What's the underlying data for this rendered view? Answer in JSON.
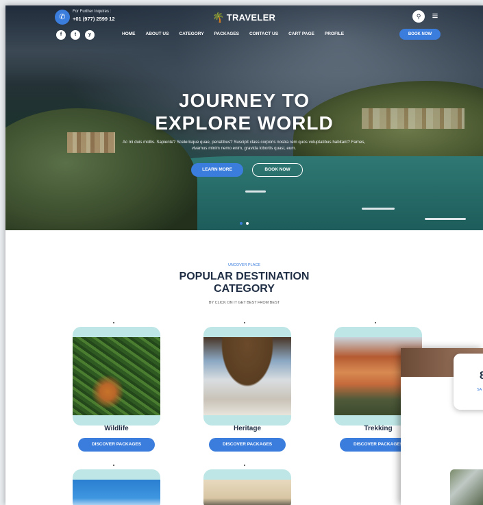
{
  "header": {
    "inquiries_label": "For Further Inquires :",
    "phone": "+01 (977) 2599 12",
    "logo_text": "TRAVELER",
    "nav": [
      "HOME",
      "ABOUT US",
      "CATEGORY",
      "PACKAGES",
      "CONTACT US",
      "CART PAGE",
      "PROFILE"
    ],
    "book_now": "BOOK NOW",
    "social": [
      "f",
      "t",
      "y"
    ]
  },
  "hero": {
    "title_line1": "JOURNEY TO",
    "title_line2": "EXPLORE WORLD",
    "text": "Ac mi duis mollis. Sapiente? Scelerisque quae, penatibus? Suscipit class corporis nostra rem quos voluptatibus habitant? Fames, vivamus minim nemo enim, gravida lobortis quasi, eum.",
    "learn_more": "LEARN MORE",
    "book_now": "BOOK NOW",
    "active_slide": 1,
    "slide_count": 2
  },
  "section": {
    "eyebrow": "UNCOVER PLACE",
    "title_line1": "POPULAR DESTINATION",
    "title_line2": "CATEGORY",
    "subtitle": "BY CLICK ON IT GET BEST FROM BEST"
  },
  "categories": [
    {
      "name": "Wildlife",
      "button": "DISCOVER PACKAGES"
    },
    {
      "name": "Heritage",
      "button": "DISCOVER PACKAGES"
    },
    {
      "name": "Trekking",
      "button": "DISCOVER PACKAGES"
    }
  ],
  "overlay": {
    "number": "8",
    "label": "SA"
  },
  "colors": {
    "accent": "#3b7ddd",
    "heading": "#1f2e44",
    "card_bg": "#bfe6e6"
  }
}
